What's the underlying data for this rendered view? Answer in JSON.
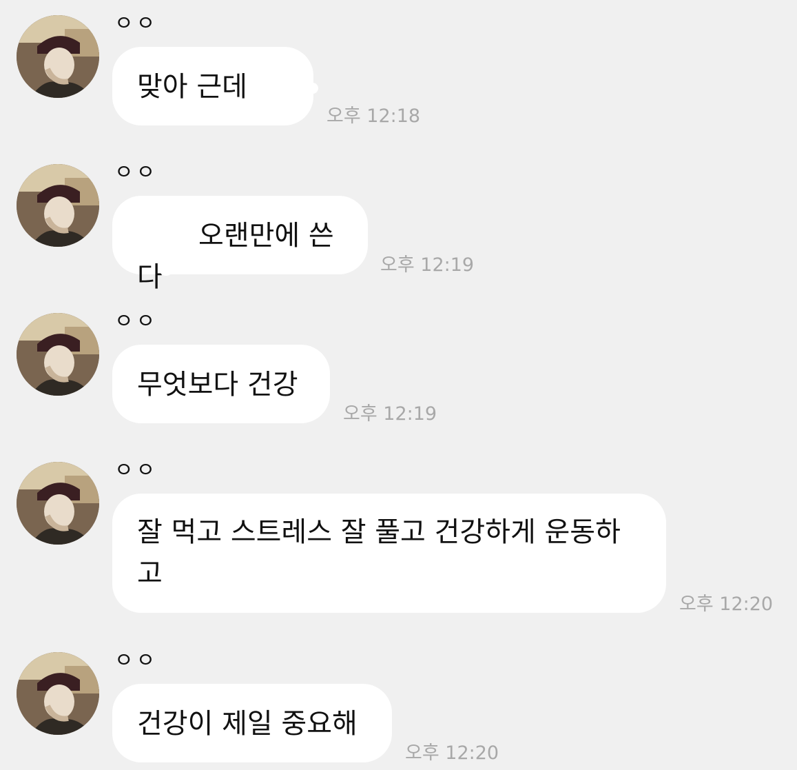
{
  "chat": {
    "messages": [
      {
        "sender": "ㅇㅇ",
        "text": "맞아 근데",
        "time": "오후 12:18"
      },
      {
        "sender": "ㅇㅇ",
        "text": "       오랜만에 쓴다",
        "time": "오후 12:19"
      },
      {
        "sender": "ㅇㅇ",
        "text": "무엇보다 건강",
        "time": "오후 12:19"
      },
      {
        "sender": "ㅇㅇ",
        "text": "잘 먹고 스트레스 잘 풀고 건강하게 운동하\n고",
        "time": "오후 12:20"
      },
      {
        "sender": "ㅇㅇ",
        "text": "건강이 제일 중요해",
        "time": "오후 12:20"
      }
    ]
  },
  "colors": {
    "background": "#f0f0f0",
    "bubble": "#ffffff",
    "text": "#111111",
    "timestamp": "#a8a8a8"
  },
  "icons": {
    "avatar": "profile-photo-avatar"
  }
}
